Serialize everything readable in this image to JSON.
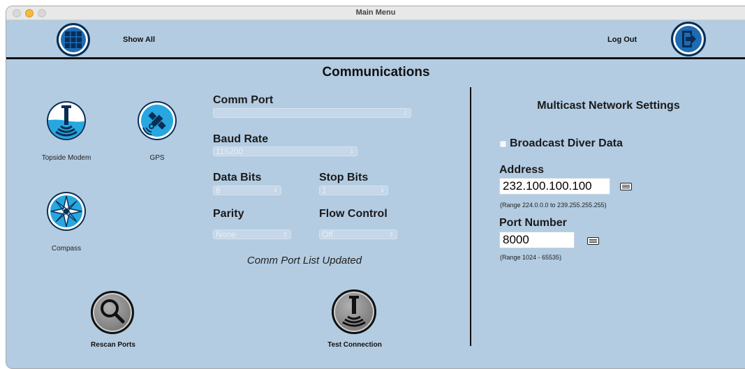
{
  "window": {
    "title": "Main Menu"
  },
  "topbar": {
    "show_all_label": "Show All",
    "log_out_label": "Log Out"
  },
  "page": {
    "section_title": "Communications"
  },
  "devices": {
    "topside_modem_label": "Topside Modem",
    "gps_label": "GPS",
    "compass_label": "Compass"
  },
  "comm": {
    "comm_port_label": "Comm Port",
    "comm_port_value": "",
    "baud_rate_label": "Baud Rate",
    "baud_rate_value": "115200",
    "data_bits_label": "Data Bits",
    "data_bits_value": "8",
    "stop_bits_label": "Stop Bits",
    "stop_bits_value": "1",
    "parity_label": "Parity",
    "parity_value": "None",
    "flow_control_label": "Flow Control",
    "flow_control_value": "Off",
    "status_text": "Comm Port List Updated"
  },
  "actions": {
    "rescan_label": "Rescan Ports",
    "test_label": "Test Connection"
  },
  "multicast": {
    "title": "Multicast Network Settings",
    "broadcast_label": "Broadcast Diver Data",
    "broadcast_checked": false,
    "address_label": "Address",
    "address_value": "232.100.100.100",
    "address_range": "(Range 224.0.0.0 to 239.255.255.255)",
    "port_label": "Port Number",
    "port_value": "8000",
    "port_range": "(Range 1024 - 65535)"
  },
  "colors": {
    "background": "#b3cce2",
    "icon_blue": "#1e6bb4",
    "icon_dark": "#0a2e55",
    "water": "#27a7e0"
  },
  "icons": [
    "grid-icon",
    "logout-icon",
    "modem-icon",
    "satellite-icon",
    "compass-icon",
    "magnifier-icon",
    "transducer-icon",
    "keyboard-icon"
  ]
}
